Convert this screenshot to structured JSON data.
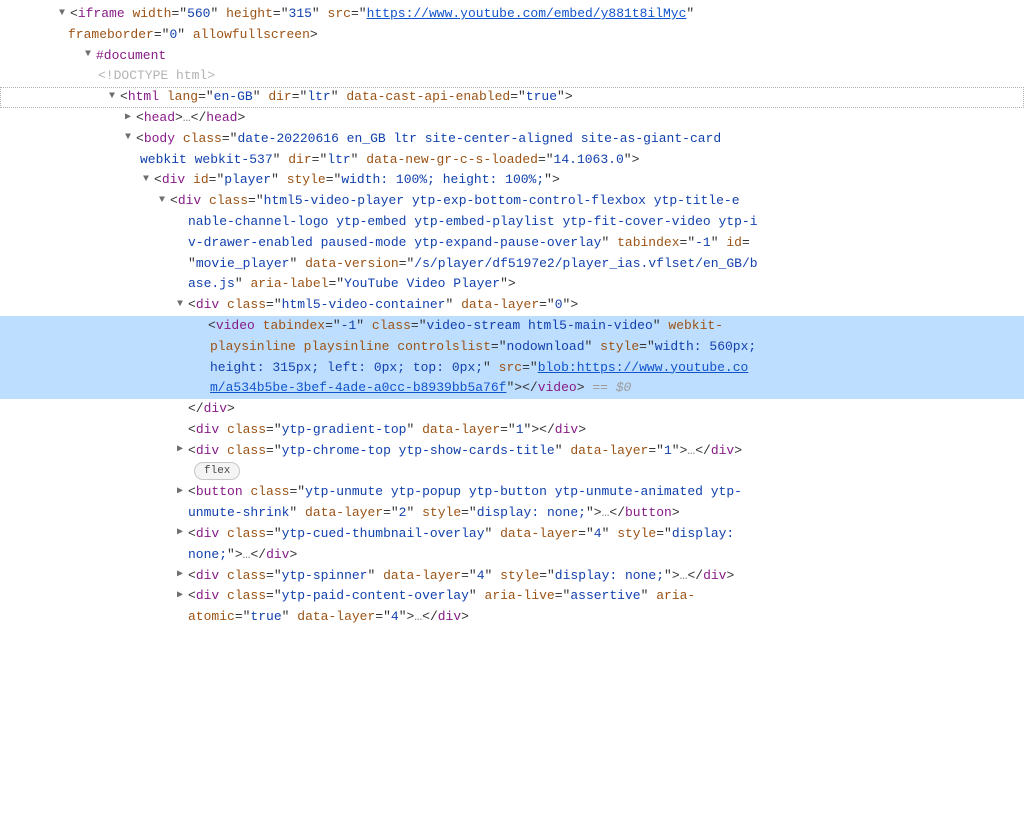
{
  "iframe": {
    "tag": "iframe",
    "width": "560",
    "height": "315",
    "src": "https://www.youtube.com/embed/y881t8ilMyc",
    "frameborder": "0",
    "allowfullscreen": "allowfullscreen"
  },
  "document": {
    "label": "#document",
    "doctype": "<!DOCTYPE html>"
  },
  "html": {
    "tag": "html",
    "lang": "en-GB",
    "dir": "ltr",
    "data_cast": "true"
  },
  "head": {
    "tag": "head",
    "ellipsis": "…"
  },
  "body_el": {
    "tag": "body",
    "class": "date-20220616 en_GB ltr  site-center-aligned site-as-giant-card webkit webkit-537",
    "dir": "ltr",
    "data_new_gr": "14.1063.0"
  },
  "player_div": {
    "tag": "div",
    "id": "player",
    "style": "width: 100%; height: 100%;"
  },
  "movie_player": {
    "tag": "div",
    "class": "html5-video-player ytp-exp-bottom-control-flexbox ytp-title-enable-channel-logo ytp-embed ytp-embed-playlist ytp-fit-cover-video ytp-iv-drawer-enabled paused-mode ytp-expand-pause-overlay",
    "tabindex": "-1",
    "id": "movie_player",
    "data_version": "/s/player/df5197e2/player_ias.vflset/en_GB/base.js",
    "aria_label": "YouTube Video Player"
  },
  "video_container": {
    "tag": "div",
    "class": "html5-video-container",
    "data_layer": "0"
  },
  "video": {
    "tag": "video",
    "tabindex": "-1",
    "class": "video-stream html5-main-video",
    "webkit_playsinline": "webkit-playsinline",
    "playsinline": "playsinline",
    "controlslist": "nodownload",
    "style": "width: 560px; height: 315px; left: 0px; top: 0px;",
    "src_prefix": "blob:https://www.youtube.co",
    "src_suffix": "m/a534b5be-3bef-4ade-a0cc-b8939bb5a76f",
    "selection": " == $0"
  },
  "close_div": "</div>",
  "gradient_top": {
    "tag": "div",
    "class": "ytp-gradient-top",
    "data_layer": "1"
  },
  "chrome_top": {
    "tag": "div",
    "class": "ytp-chrome-top ytp-show-cards-title",
    "data_layer": "1"
  },
  "flex_badge": "flex",
  "unmute_btn": {
    "tag": "button",
    "class": "ytp-unmute ytp-popup ytp-button ytp-unmute-animated ytp-unmute-shrink",
    "data_layer": "2",
    "style": "display: none;"
  },
  "cued_overlay": {
    "tag": "div",
    "class": "ytp-cued-thumbnail-overlay",
    "data_layer": "4",
    "style": "display: none;"
  },
  "spinner": {
    "tag": "div",
    "class": "ytp-spinner",
    "data_layer": "4",
    "style": "display: none;"
  },
  "paid_overlay": {
    "tag": "div",
    "class": "ytp-paid-content-overlay",
    "aria_live": "assertive",
    "aria_atomic": "true",
    "data_layer": "4"
  }
}
